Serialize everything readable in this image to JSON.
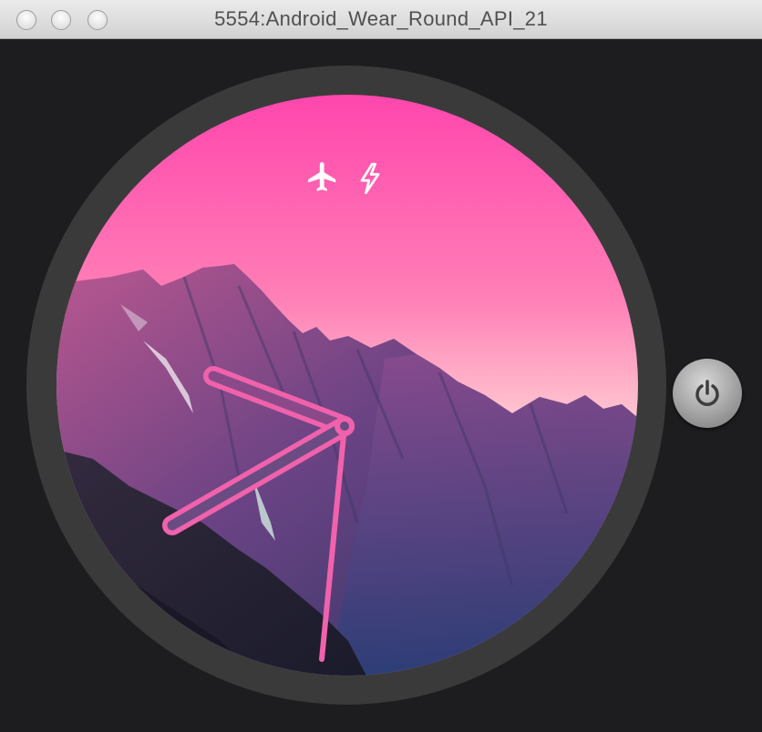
{
  "window": {
    "title": "5554:Android_Wear_Round_API_21",
    "buttons": [
      "close",
      "minimize",
      "zoom"
    ]
  },
  "watch": {
    "status_icons": [
      "airplane-mode-icon",
      "charging-icon"
    ],
    "face": "analog",
    "accent_color": "#f062ab",
    "sky_top_color": "#ff4fb0",
    "sky_bottom_color": "#ffd6d9"
  },
  "power_button": {
    "icon": "power-icon"
  }
}
